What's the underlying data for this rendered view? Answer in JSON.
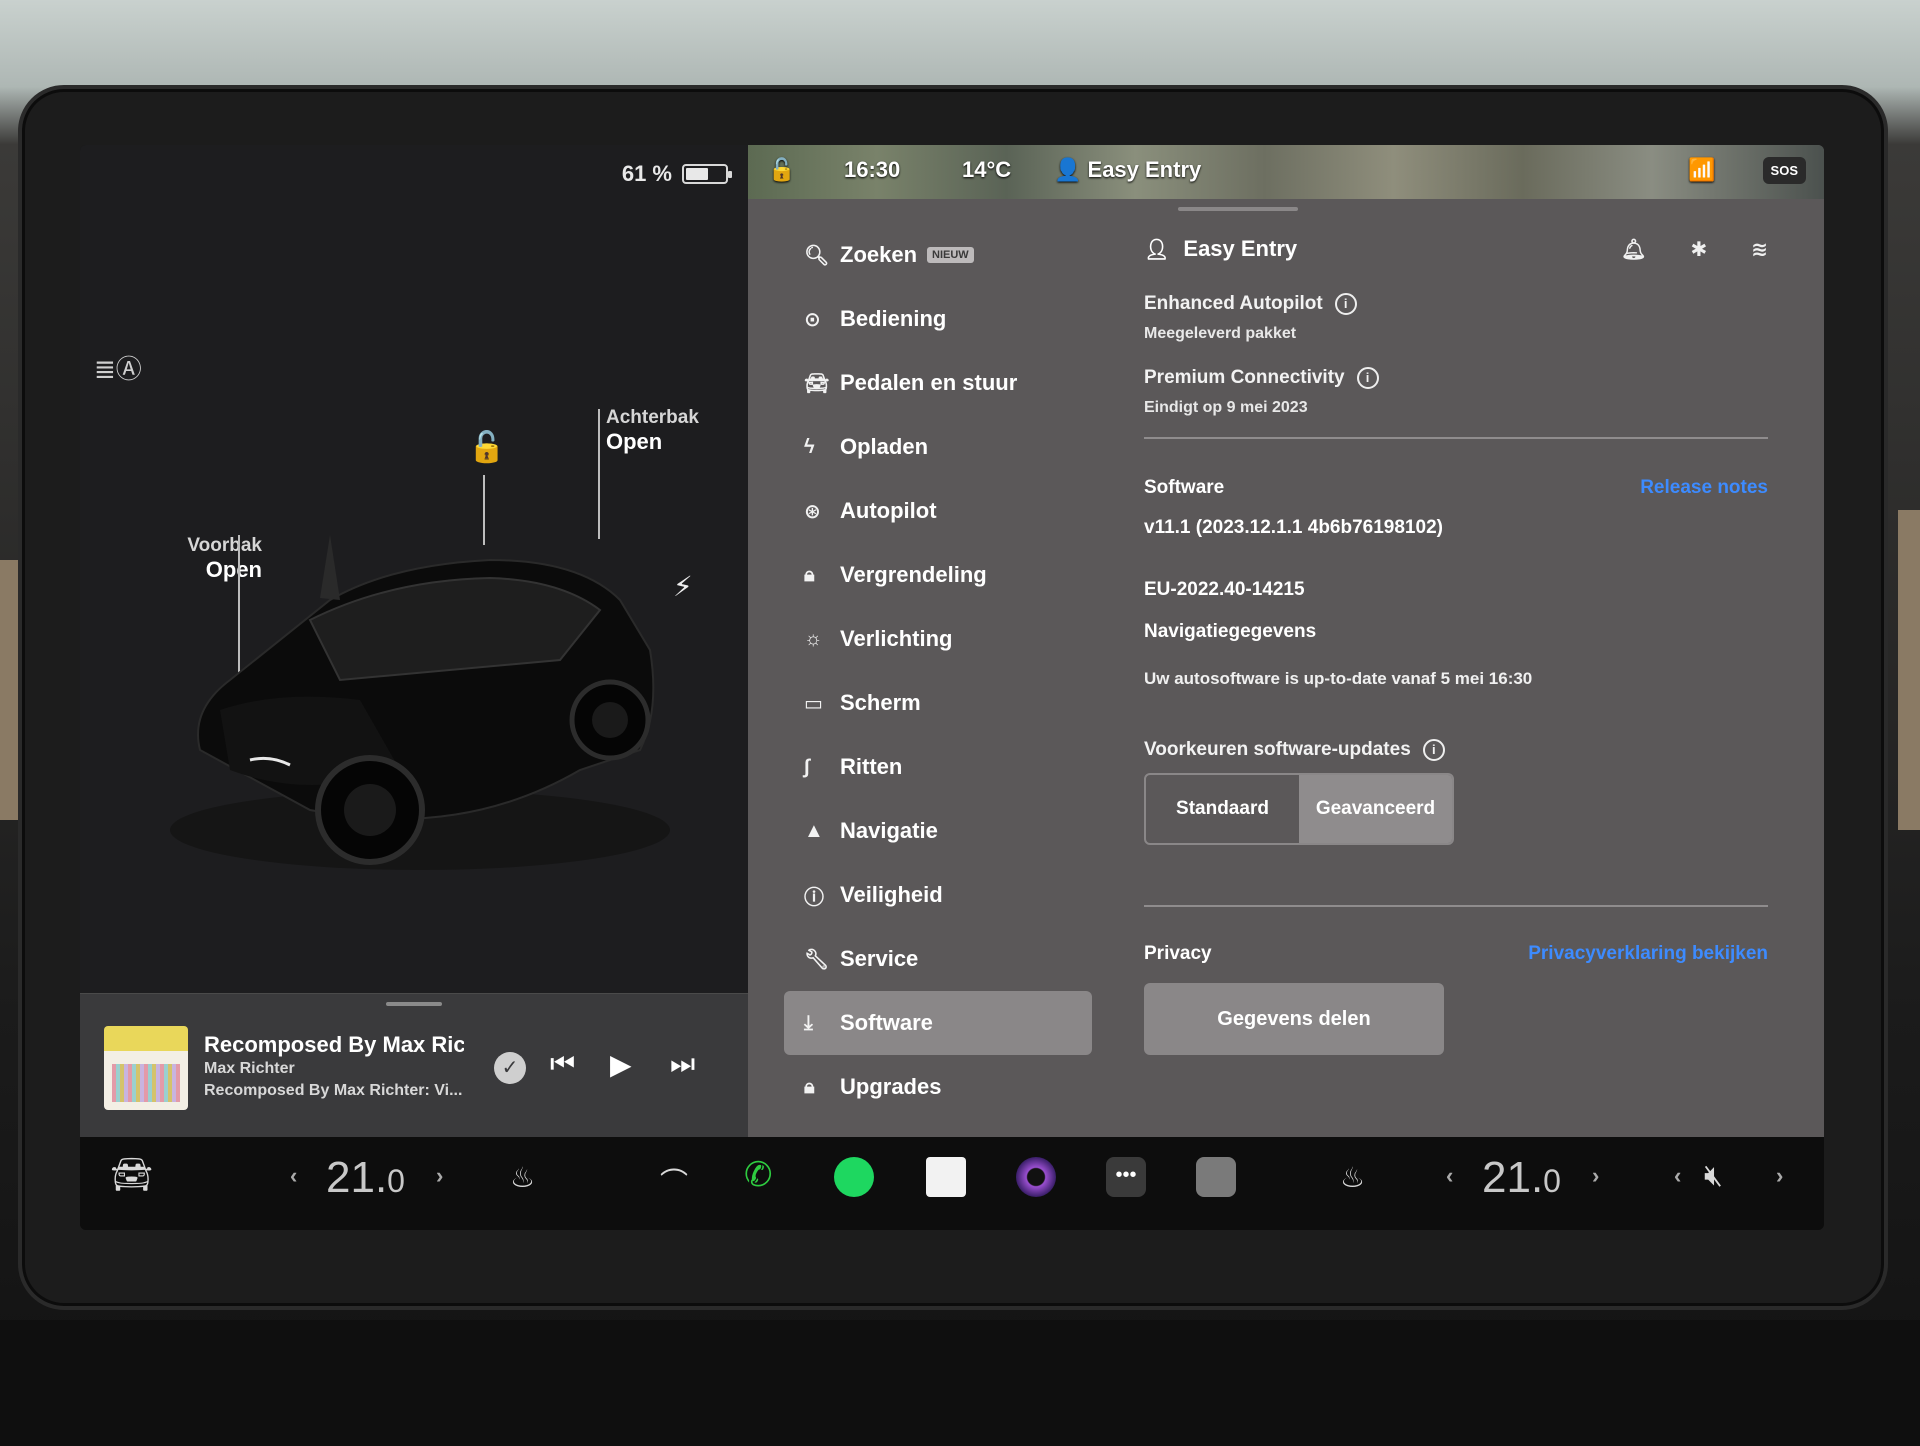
{
  "status": {
    "battery": "61 %",
    "time": "16:30",
    "temperature": "14°C",
    "profile": "Easy Entry",
    "sos": "SOS",
    "battery_level": 0.61
  },
  "car": {
    "frunk_title": "Voorbak",
    "frunk_state": "Open",
    "trunk_title": "Achterbak",
    "trunk_state": "Open"
  },
  "media": {
    "title": "Recomposed By Max Ricl",
    "artist": "Max Richter",
    "source": "Recomposed By Max Richter: Vi..."
  },
  "nav": {
    "items": [
      {
        "label": "Zoeken",
        "icon": "search-icon",
        "badge": "NIEUW"
      },
      {
        "label": "Bediening",
        "icon": "toggle-icon"
      },
      {
        "label": "Pedalen en stuur",
        "icon": "car-icon"
      },
      {
        "label": "Opladen",
        "icon": "bolt-icon"
      },
      {
        "label": "Autopilot",
        "icon": "steering-wheel-icon"
      },
      {
        "label": "Vergrendeling",
        "icon": "lock-icon"
      },
      {
        "label": "Verlichting",
        "icon": "sun-icon"
      },
      {
        "label": "Scherm",
        "icon": "display-icon"
      },
      {
        "label": "Ritten",
        "icon": "trips-icon"
      },
      {
        "label": "Navigatie",
        "icon": "navigation-icon"
      },
      {
        "label": "Veiligheid",
        "icon": "alert-icon"
      },
      {
        "label": "Service",
        "icon": "wrench-icon"
      },
      {
        "label": "Software",
        "icon": "download-icon",
        "active": true
      },
      {
        "label": "Upgrades",
        "icon": "bag-icon"
      }
    ]
  },
  "content": {
    "profile_name": "Easy Entry",
    "feature1_name": "Enhanced Autopilot",
    "feature1_sub": "Meegeleverd pakket",
    "feature2_name": "Premium Connectivity",
    "feature2_sub": "Eindigt op 9 mei 2023",
    "software_label": "Software",
    "release_notes": "Release notes",
    "version": "v11.1 (2023.12.1.1 4b6b76198102)",
    "nav_version": "EU-2022.40-14215",
    "nav_data_label": "Navigatiegegevens",
    "uptodate": "Uw autosoftware is up-to-date vanaf 5 mei 16:30",
    "updates_pref_label": "Voorkeuren software-updates",
    "seg_standard": "Standaard",
    "seg_advanced": "Geavanceerd",
    "privacy_label": "Privacy",
    "privacy_link": "Privacyverklaring bekijken",
    "share_button": "Gegevens delen"
  },
  "dock": {
    "temp_left_int": "21.",
    "temp_left_dec": "0",
    "temp_right_int": "21.",
    "temp_right_dec": "0"
  },
  "colors": {
    "accent_link": "#3d8bff",
    "active_nav": "#8a8788",
    "panel": "#5b5859",
    "spotify": "#1ed760",
    "phone": "#2ecc40"
  }
}
